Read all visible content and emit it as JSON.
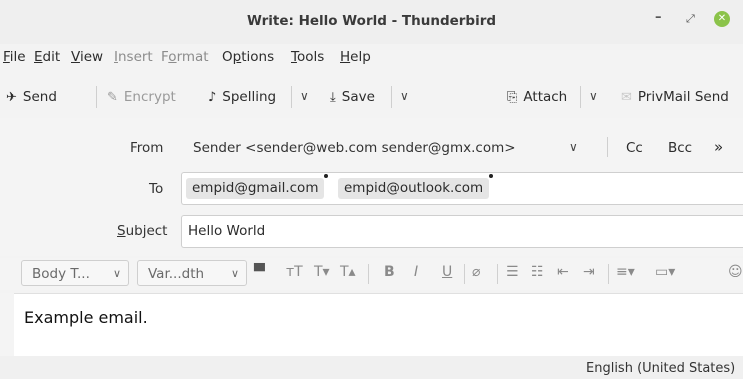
{
  "window": {
    "title": "Write: Hello World - Thunderbird"
  },
  "menu": [
    {
      "label": "File",
      "u": "F",
      "rest": "ile",
      "disabled": false
    },
    {
      "label": "Edit",
      "u": "E",
      "rest": "dit",
      "disabled": false
    },
    {
      "label": "View",
      "u": "V",
      "rest": "iew",
      "disabled": false
    },
    {
      "label": "Insert",
      "u": "I",
      "rest": "nsert",
      "disabled": true
    },
    {
      "label": "Format",
      "pre": "F",
      "u": "o",
      "rest": "rmat",
      "disabled": true
    },
    {
      "label": "Options",
      "pre": "O",
      "u": "p",
      "rest": "tions",
      "disabled": false
    },
    {
      "label": "Tools",
      "u": "T",
      "rest": "ools",
      "disabled": false
    },
    {
      "label": "Help",
      "u": "H",
      "rest": "elp",
      "disabled": false
    }
  ],
  "toolbar": {
    "send": "Send",
    "encrypt": "Encrypt",
    "spelling": "Spelling",
    "save": "Save",
    "attach": "Attach",
    "privmail": "PrivMail Send"
  },
  "header": {
    "from_label": "From",
    "from_value": "Sender <sender@web.com sender@gmx.com>",
    "cc": "Cc",
    "bcc": "Bcc",
    "to_label": "To",
    "recipients": [
      "empid@gmail.com",
      "empid@outlook.com"
    ],
    "subject_label": "Subject",
    "subject_value": "Hello World"
  },
  "format": {
    "paragraph": "Body T...",
    "font": "Var...dth"
  },
  "body": {
    "text": "Example email."
  },
  "status": {
    "language": "English (United States)"
  }
}
